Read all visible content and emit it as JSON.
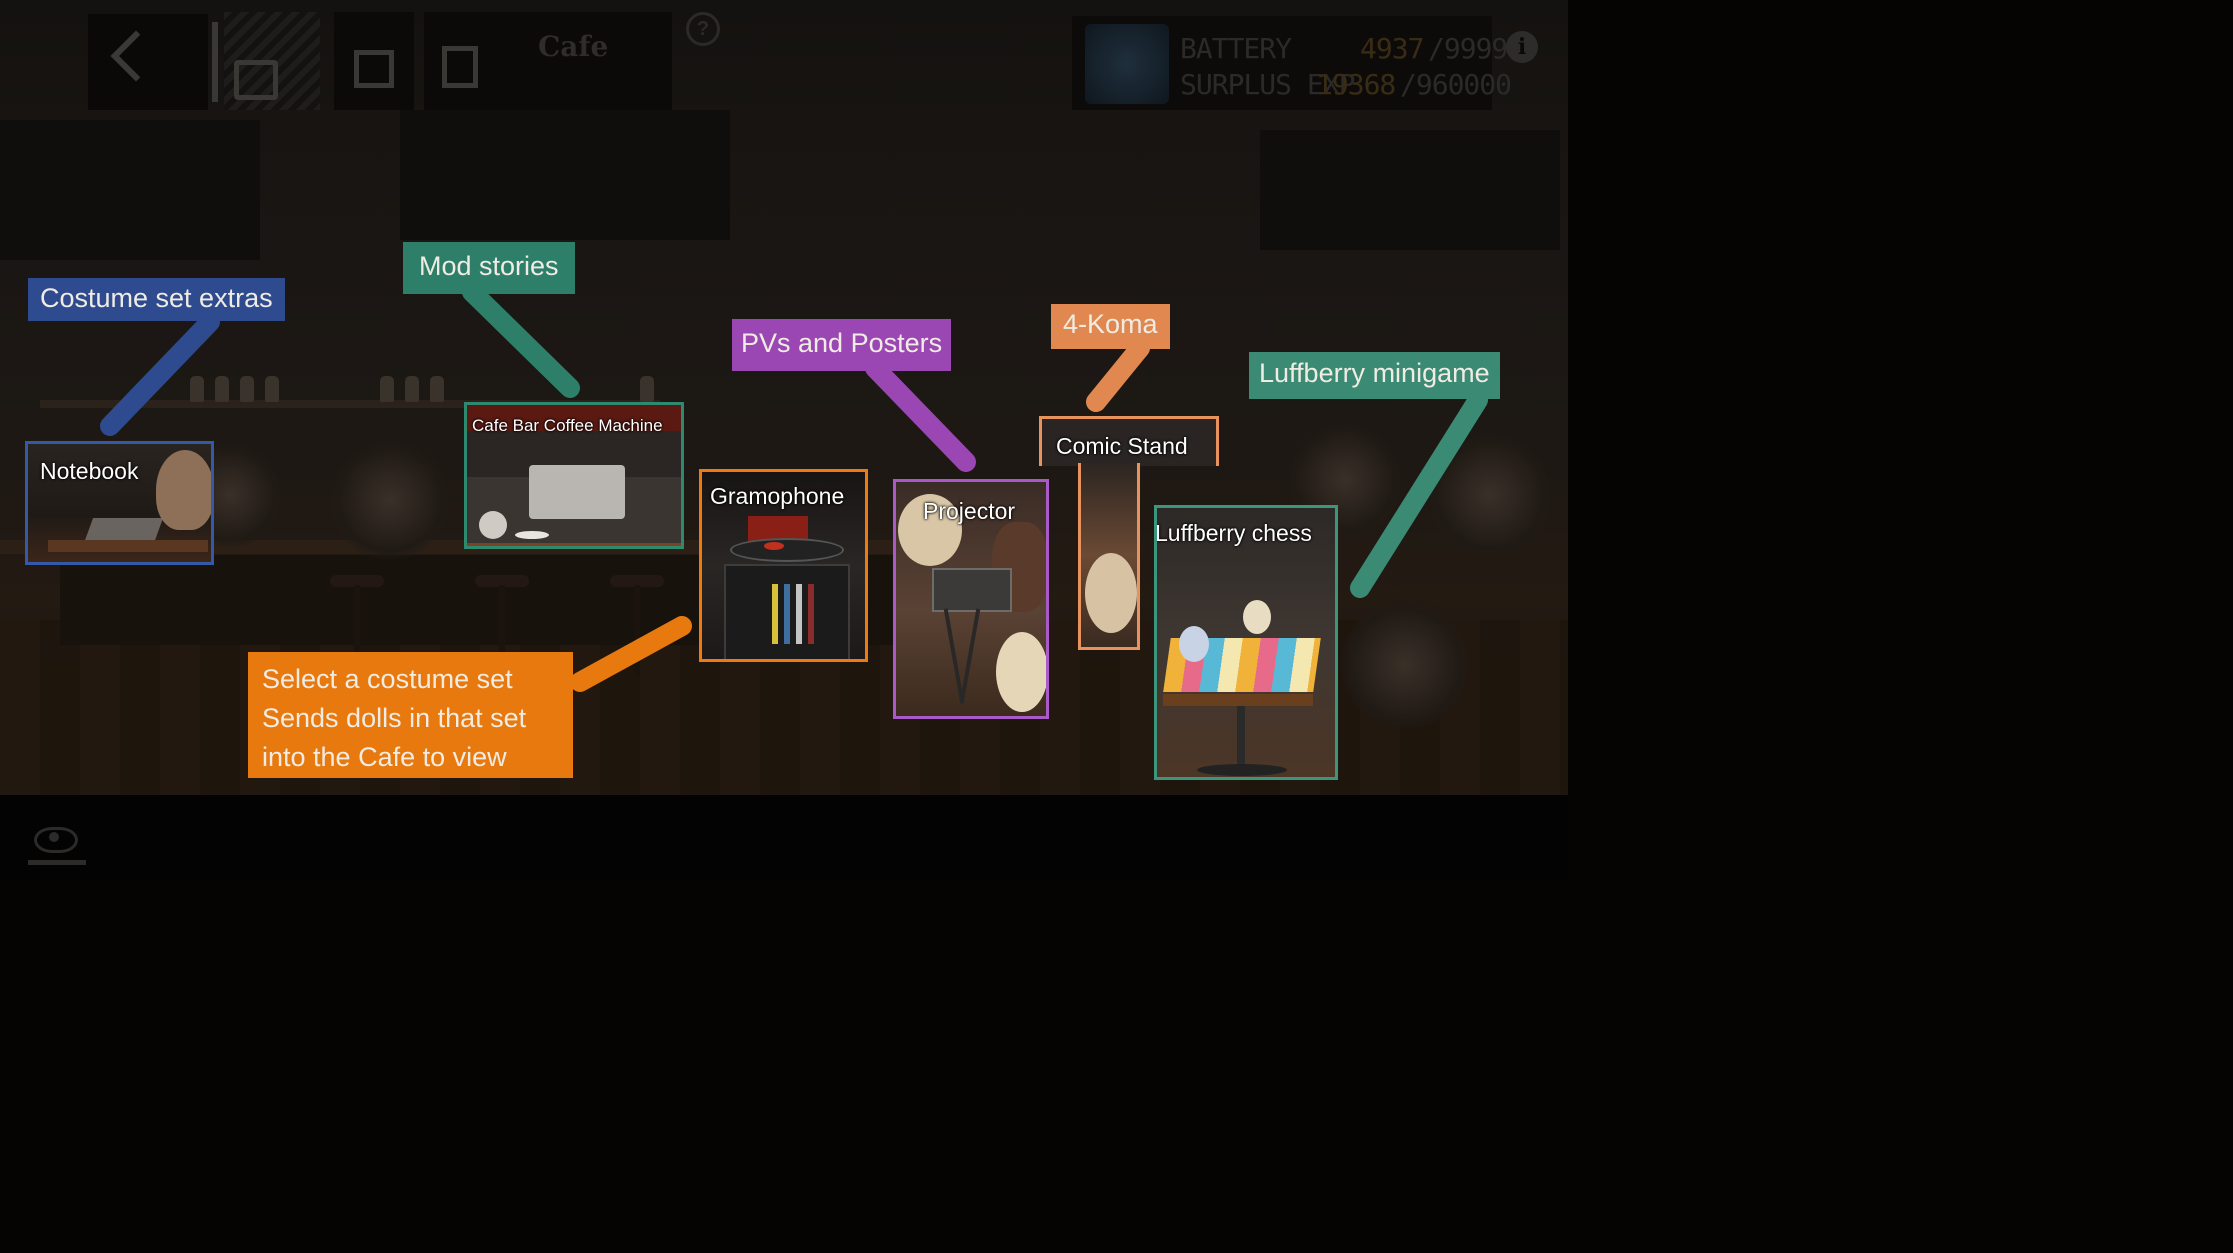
{
  "hud": {
    "title": "Cafe",
    "help": "?",
    "info": "i",
    "battery_label": "BATTERY",
    "battery_current": "4937",
    "battery_max": "/9999",
    "exp_label": "SURPLUS EXP",
    "exp_current": "19368",
    "exp_max": "/960000"
  },
  "boxes": {
    "notebook": "Notebook",
    "coffee_machine": "Cafe Bar Coffee Machine",
    "gramophone": "Gramophone",
    "projector": "Projector",
    "comic_stand": "Comic Stand",
    "luffberry_chess": "Luffberry chess"
  },
  "callouts": {
    "costume_extras": "Costume set extras",
    "mod_stories": "Mod stories",
    "pvs_posters": "PVs and Posters",
    "four_koma": "4-Koma",
    "luffberry_minigame": "Luffberry minigame",
    "select_costume": [
      "Select a costume set",
      "Sends dolls in that set",
      "into the Cafe to view"
    ]
  },
  "colors": {
    "blue": "#2e4b8f",
    "green": "#2e7f6a",
    "orange": "#e8790f",
    "purple": "#9b47b3",
    "peach": "#e0884f",
    "teal": "#3a8a74",
    "gold": "#3a2c14"
  }
}
